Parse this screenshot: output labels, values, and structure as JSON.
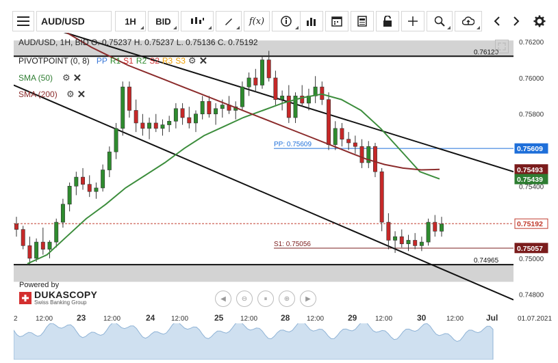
{
  "toolbar": {
    "menu_icon": "menu-icon",
    "symbol": "AUD/USD",
    "timeframe": "1H",
    "price_type": "BID",
    "icons": [
      "candle-type-icon",
      "draw-icon",
      "function-icon",
      "info-icon",
      "indicator-icon",
      "calendar-icon",
      "news-icon",
      "lock-icon",
      "crosshair-icon",
      "zoom-icon",
      "cloud-upload-icon",
      "prev-icon",
      "next-icon",
      "settings-icon"
    ]
  },
  "header": {
    "ohlc": "AUD/USD,  1H, BID    O. 0.75237 H. 0.75237 L. 0.75136 C. 0.75192"
  },
  "indicators": {
    "pivot_label": "PIVOTPOINT (0, 8)",
    "pivot_levels": [
      {
        "label": "PP",
        "color": "#3a78d8"
      },
      {
        "label": "R1",
        "color": "#2e8b2e"
      },
      {
        "label": "S1",
        "color": "#d03030"
      },
      {
        "label": "R2",
        "color": "#2e8b2e"
      },
      {
        "label": "S2",
        "color": "#d03030"
      },
      {
        "label": "R3",
        "color": "#f0a000"
      },
      {
        "label": "S3",
        "color": "#f0a000"
      }
    ],
    "sma50_label": "SMA (50)",
    "sma200_label": "SMA (200)"
  },
  "branding": {
    "powered_by": "Powered by",
    "brand": "DUKASCOPY",
    "tagline": "Swiss Banking Group"
  },
  "chart_data": {
    "type": "line",
    "title": "",
    "yaxis": {
      "ticks": [
        "0.76200",
        "0.76000",
        "0.75800",
        "0.75400",
        "0.75000",
        "0.74800"
      ],
      "ylim": [
        0.747,
        0.7625
      ]
    },
    "x_ticks": [
      "2",
      "12:00",
      "23",
      "12:00",
      "24",
      "12:00",
      "25",
      "12:00",
      "28",
      "12:00",
      "29",
      "12:00",
      "30",
      "12:00",
      "Jul",
      "01.07.2021"
    ],
    "price_labels": [
      {
        "value": "0.75609",
        "color": "#1e6fd9",
        "text_color": "#ffffff"
      },
      {
        "value": "0.75493",
        "color": "#7a1c1c",
        "text_color": "#ffffff"
      },
      {
        "value": "0.75439",
        "color": "#2e7d32",
        "text_color": "#ffffff"
      },
      {
        "value": "0.75192",
        "color": "#ffffff",
        "text_color": "#c0392b"
      },
      {
        "value": "0.75057",
        "color": "#7a1c1c",
        "text_color": "#ffffff"
      }
    ],
    "annotations": [
      {
        "text": "0.76120",
        "y": 0.7612
      },
      {
        "text": "PP: 0.75609",
        "y": 0.75609
      },
      {
        "text": "S1: 0.75056",
        "y": 0.75056
      },
      {
        "text": "0.74965",
        "y": 0.74965
      }
    ],
    "series": [
      {
        "name": "SMA (50)",
        "color": "#3c8d3c",
        "values": [
          0.7497,
          0.7502,
          0.7512,
          0.7522,
          0.753,
          0.7539,
          0.7546,
          0.7553,
          0.7561,
          0.7568,
          0.7573,
          0.7578,
          0.7582,
          0.7586,
          0.7589,
          0.7591,
          0.7588,
          0.7582,
          0.7572,
          0.756,
          0.7548,
          0.7544
        ]
      },
      {
        "name": "SMA (200)",
        "color": "#8b2b2b",
        "values": [
          0.7629,
          0.7623,
          0.7617,
          0.7612,
          0.7607,
          0.7603,
          0.7599,
          0.7595,
          0.7591,
          0.7587,
          0.7583,
          0.7579,
          0.7575,
          0.7571,
          0.7567,
          0.7563,
          0.7559,
          0.7555,
          0.7552,
          0.755,
          0.7549,
          0.75493
        ]
      }
    ],
    "candles": [
      [
        0.7519,
        0.7523,
        0.7512,
        0.7516
      ],
      [
        0.7516,
        0.7518,
        0.7505,
        0.7507
      ],
      [
        0.7507,
        0.7512,
        0.7496,
        0.75
      ],
      [
        0.75,
        0.7511,
        0.7498,
        0.7509
      ],
      [
        0.7509,
        0.7517,
        0.7502,
        0.7505
      ],
      [
        0.7505,
        0.751,
        0.75,
        0.7509
      ],
      [
        0.7509,
        0.7522,
        0.7506,
        0.752
      ],
      [
        0.752,
        0.7533,
        0.7517,
        0.753
      ],
      [
        0.753,
        0.7542,
        0.7526,
        0.754
      ],
      [
        0.754,
        0.7548,
        0.7535,
        0.7545
      ],
      [
        0.7545,
        0.755,
        0.7538,
        0.7541
      ],
      [
        0.7541,
        0.7546,
        0.7534,
        0.7537
      ],
      [
        0.7537,
        0.7542,
        0.7533,
        0.7539
      ],
      [
        0.7539,
        0.7552,
        0.7537,
        0.7549
      ],
      [
        0.7549,
        0.7562,
        0.7545,
        0.7559
      ],
      [
        0.7559,
        0.7575,
        0.7555,
        0.7572
      ],
      [
        0.7572,
        0.7598,
        0.7568,
        0.7595
      ],
      [
        0.7595,
        0.7598,
        0.7578,
        0.7582
      ],
      [
        0.7582,
        0.7588,
        0.757,
        0.7575
      ],
      [
        0.7575,
        0.758,
        0.7568,
        0.7572
      ],
      [
        0.7572,
        0.7578,
        0.7566,
        0.7575
      ],
      [
        0.7575,
        0.758,
        0.757,
        0.7572
      ],
      [
        0.7572,
        0.7577,
        0.7568,
        0.7574
      ],
      [
        0.7574,
        0.7579,
        0.757,
        0.7576
      ],
      [
        0.7576,
        0.7586,
        0.7572,
        0.7583
      ],
      [
        0.7583,
        0.7586,
        0.7574,
        0.7578
      ],
      [
        0.7578,
        0.7584,
        0.7572,
        0.7575
      ],
      [
        0.7575,
        0.7582,
        0.757,
        0.758
      ],
      [
        0.758,
        0.759,
        0.7577,
        0.7587
      ],
      [
        0.7587,
        0.759,
        0.7578,
        0.758
      ],
      [
        0.758,
        0.7586,
        0.7574,
        0.7583
      ],
      [
        0.7583,
        0.7588,
        0.7578,
        0.7585
      ],
      [
        0.7585,
        0.759,
        0.758,
        0.7582
      ],
      [
        0.7582,
        0.7587,
        0.7577,
        0.7584
      ],
      [
        0.7584,
        0.7598,
        0.7582,
        0.7595
      ],
      [
        0.7595,
        0.7603,
        0.759,
        0.76
      ],
      [
        0.76,
        0.7605,
        0.7592,
        0.7596
      ],
      [
        0.7596,
        0.7612,
        0.7594,
        0.761
      ],
      [
        0.761,
        0.7615,
        0.7598,
        0.76
      ],
      [
        0.76,
        0.7604,
        0.7585,
        0.7588
      ],
      [
        0.7588,
        0.7593,
        0.7582,
        0.759
      ],
      [
        0.759,
        0.7596,
        0.7575,
        0.7578
      ],
      [
        0.7578,
        0.7592,
        0.7575,
        0.759
      ],
      [
        0.759,
        0.7596,
        0.7584,
        0.7586
      ],
      [
        0.7586,
        0.7594,
        0.7582,
        0.759
      ],
      [
        0.759,
        0.7601,
        0.7586,
        0.7595
      ],
      [
        0.7595,
        0.7598,
        0.7585,
        0.7588
      ],
      [
        0.7588,
        0.7592,
        0.756,
        0.7563
      ],
      [
        0.7563,
        0.7576,
        0.756,
        0.7572
      ],
      [
        0.7572,
        0.7575,
        0.7562,
        0.7566
      ],
      [
        0.7566,
        0.757,
        0.756,
        0.7564
      ],
      [
        0.7564,
        0.7568,
        0.7558,
        0.7562
      ],
      [
        0.7562,
        0.7566,
        0.755,
        0.7553
      ],
      [
        0.7553,
        0.7565,
        0.755,
        0.7562
      ],
      [
        0.7562,
        0.7564,
        0.7545,
        0.7548
      ],
      [
        0.7548,
        0.755,
        0.7515,
        0.752
      ],
      [
        0.752,
        0.7525,
        0.7505,
        0.751
      ],
      [
        0.751,
        0.7515,
        0.7503,
        0.7512
      ],
      [
        0.7512,
        0.7516,
        0.7506,
        0.7508
      ],
      [
        0.7508,
        0.7513,
        0.7504,
        0.751
      ],
      [
        0.751,
        0.7514,
        0.7505,
        0.7507
      ],
      [
        0.7507,
        0.7512,
        0.7504,
        0.7509
      ],
      [
        0.7509,
        0.7522,
        0.7507,
        0.752
      ],
      [
        0.752,
        0.7524,
        0.7512,
        0.7515
      ],
      [
        0.7515,
        0.7523,
        0.7512,
        0.7519
      ]
    ]
  },
  "nav_controls": [
    "nav-left-icon",
    "zoom-out-icon",
    "fit-icon",
    "zoom-in-icon",
    "nav-right-icon"
  ]
}
